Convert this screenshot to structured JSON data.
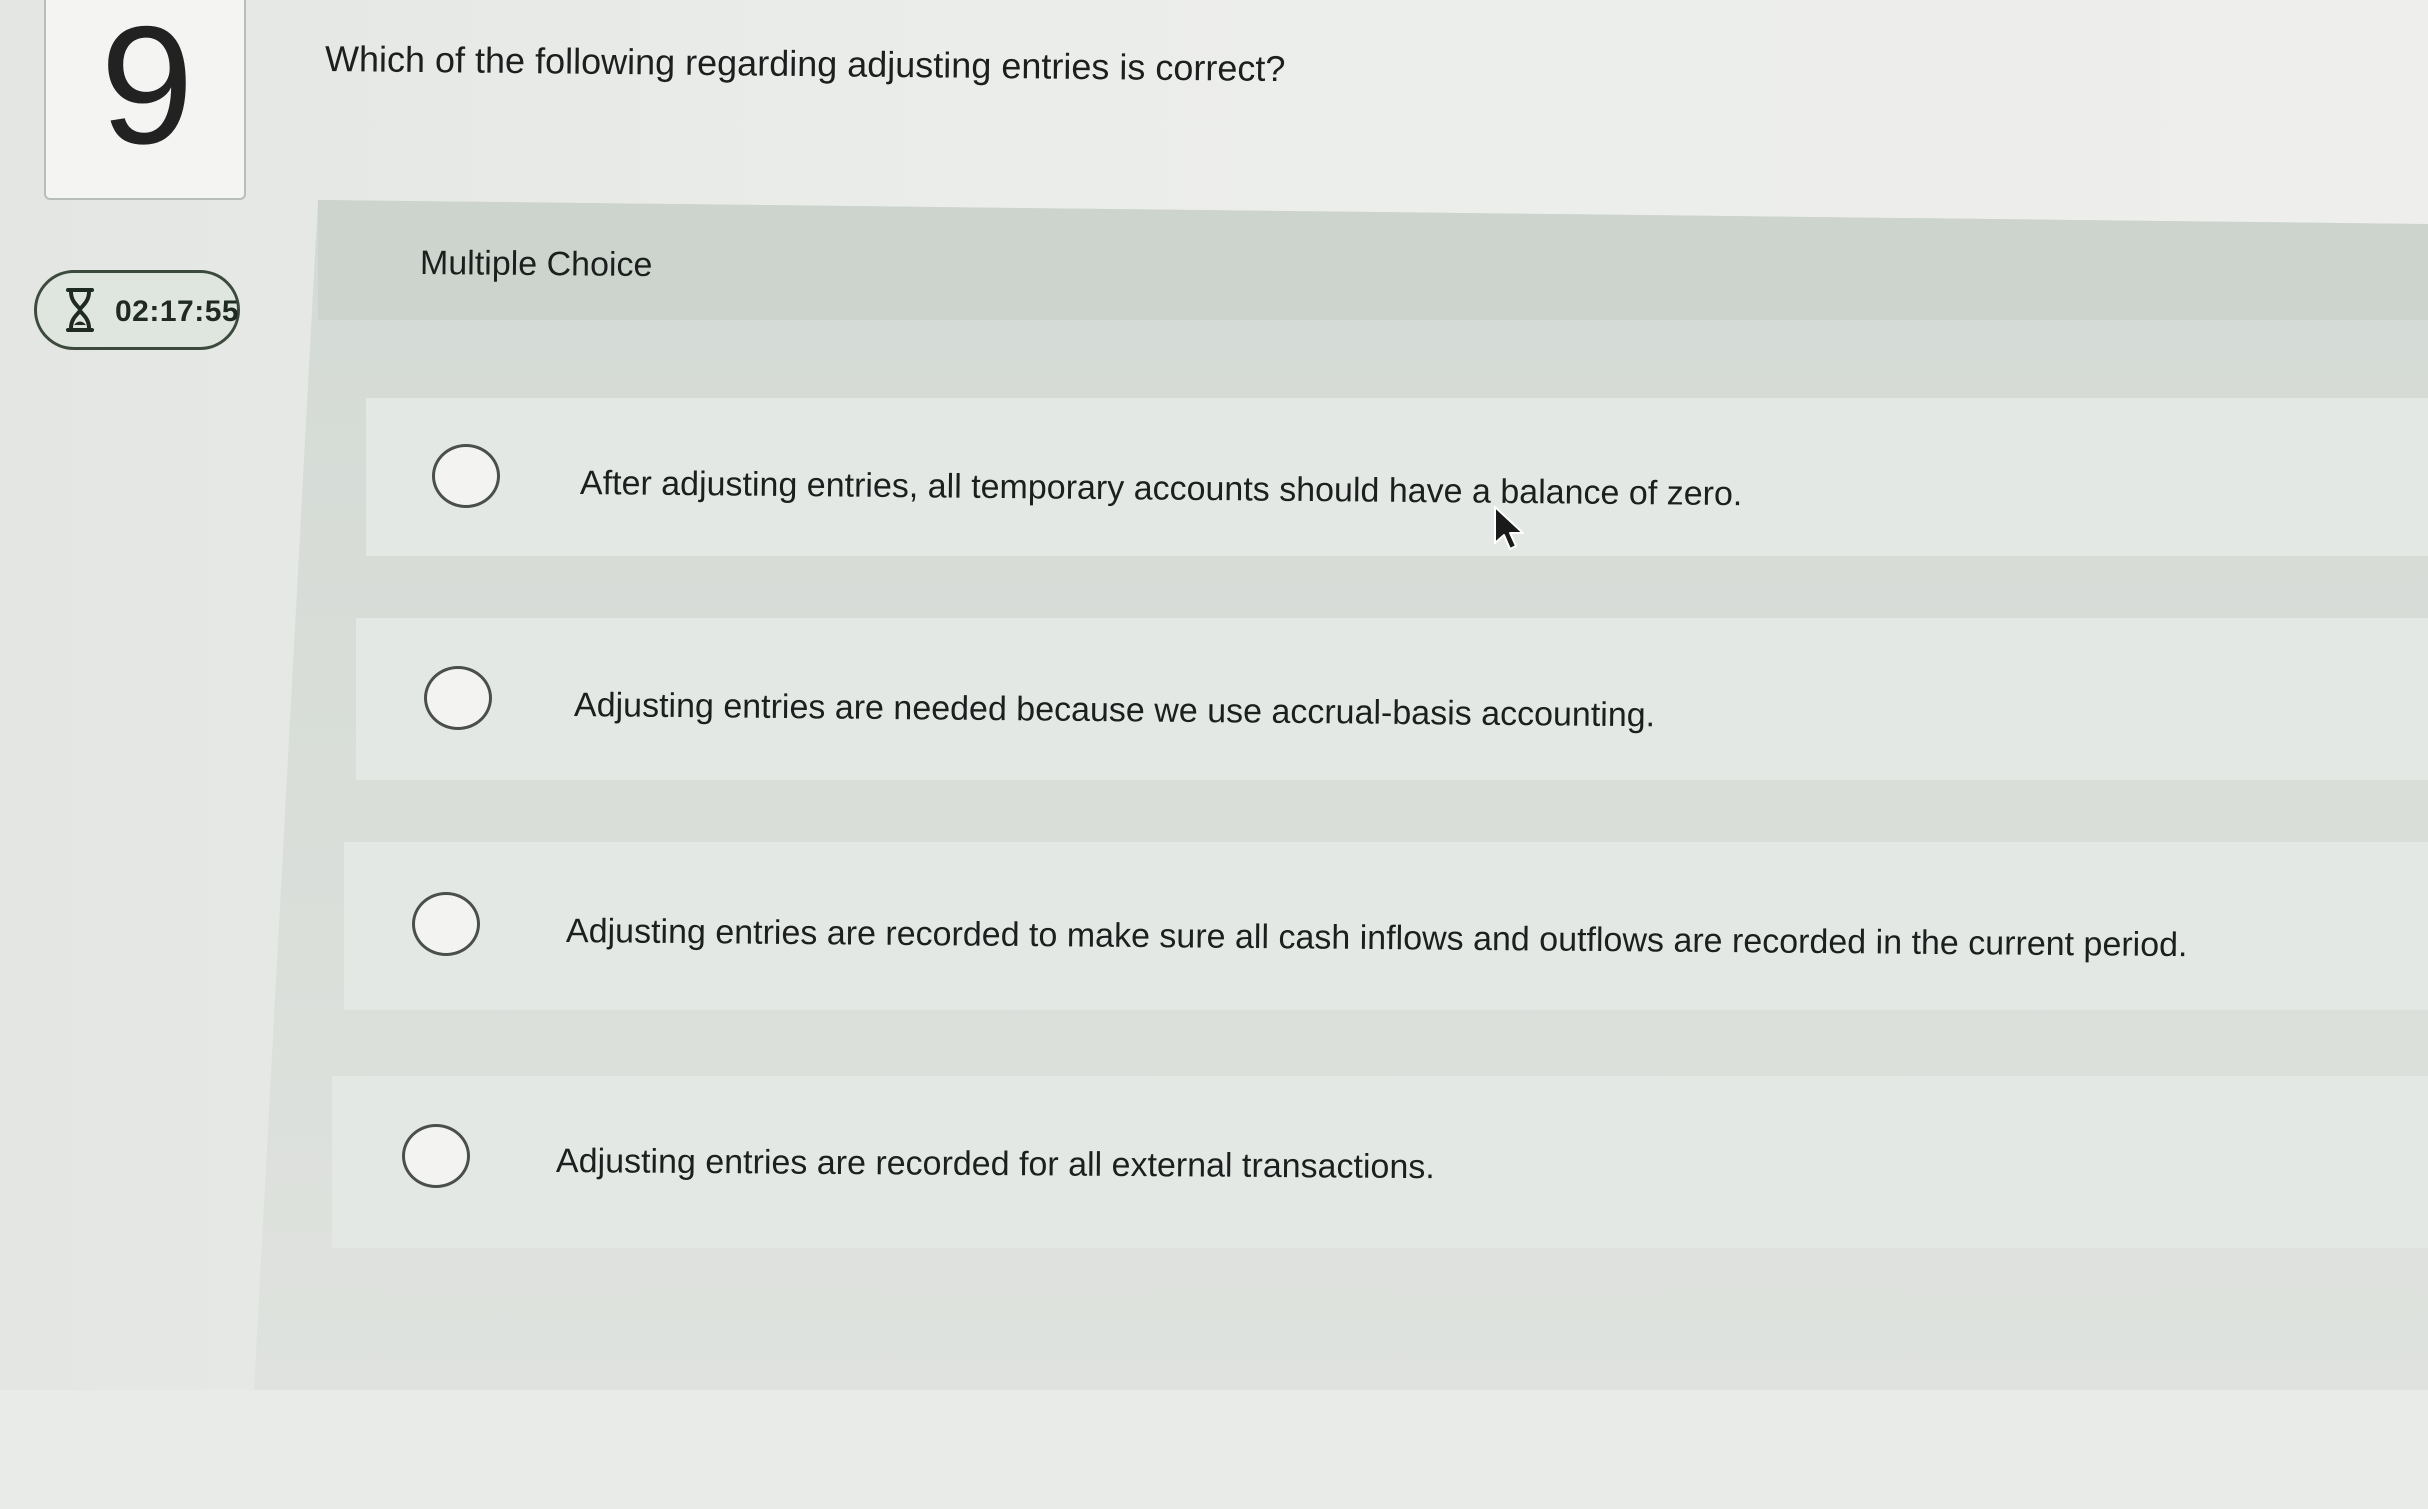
{
  "question_number": "9",
  "timer": {
    "value": "02:17:55",
    "icon": "hourglass-icon"
  },
  "question": {
    "text": "Which of the following regarding adjusting entries is correct?"
  },
  "multiple_choice": {
    "title": "Multiple Choice",
    "options": [
      {
        "label": "After adjusting entries, all temporary accounts should have a balance of zero.",
        "selected": false
      },
      {
        "label": "Adjusting entries are needed because we use accrual-basis accounting.",
        "selected": false
      },
      {
        "label": "Adjusting entries are recorded to make sure all cash inflows and outflows are recorded in the current period.",
        "selected": false
      },
      {
        "label": "Adjusting entries are recorded for all external transactions.",
        "selected": false
      }
    ]
  },
  "colors": {
    "radio_border": "#4a4f4b",
    "timer_border": "#3c4a3e",
    "option_background": "#e4e8e4"
  }
}
